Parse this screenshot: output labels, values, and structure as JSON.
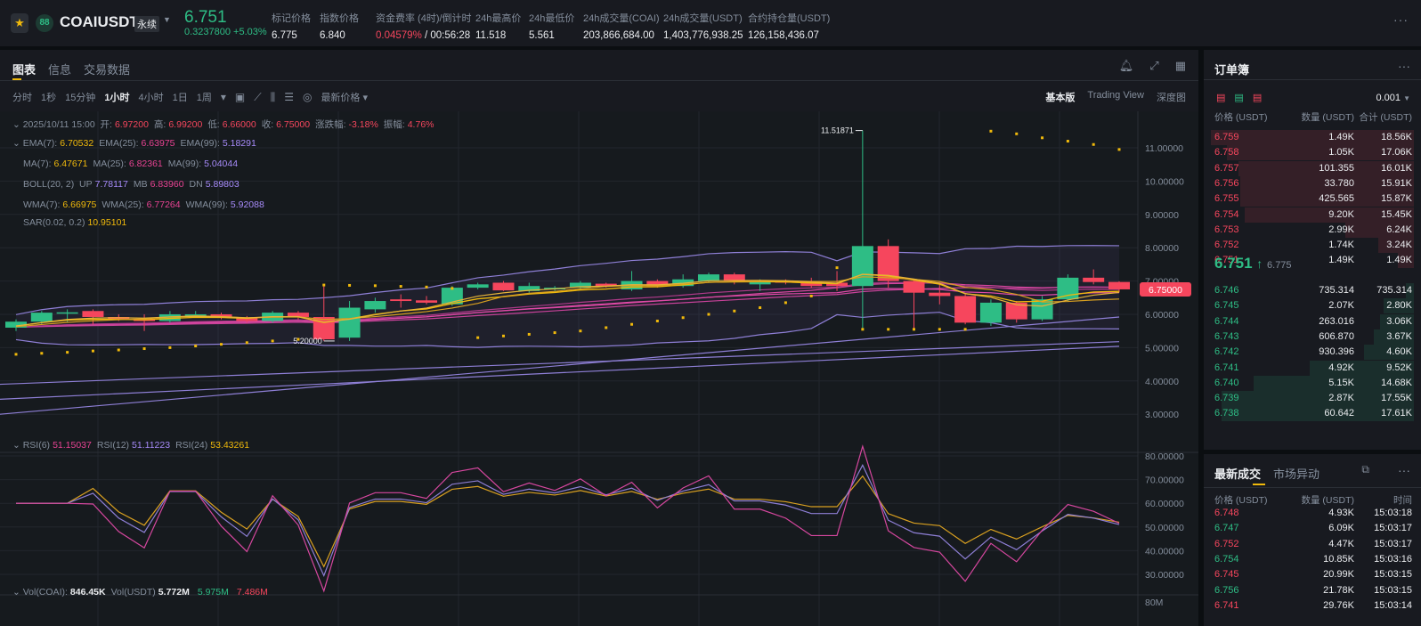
{
  "header": {
    "symbol": "COAIUSDT",
    "contract_type": "永续",
    "last_price": "6.751",
    "change": "0.3237800 +5.03%",
    "stats": [
      {
        "label": "标记价格",
        "value": "6.775"
      },
      {
        "label": "指数价格",
        "value": "6.840"
      },
      {
        "label": "资金费率 (4时)/倒计时",
        "value_rate": "0.04579%",
        "value": "/ 00:56:28"
      },
      {
        "label": "24h最高价",
        "value": "11.518"
      },
      {
        "label": "24h最低价",
        "value": "5.561"
      },
      {
        "label": "24h成交量(COAI)",
        "value": "203,866,684.00"
      },
      {
        "label": "24h成交量(USDT)",
        "value": "1,403,776,938.25"
      },
      {
        "label": "合约持仓量(USDT)",
        "value": "126,158,436.07"
      }
    ]
  },
  "tabs": [
    "图表",
    "信息",
    "交易数据"
  ],
  "toolbar": {
    "intervals": [
      "分时",
      "1秒",
      "15分钟",
      "1小时",
      "4小时",
      "1日",
      "1周"
    ],
    "active": "1小时",
    "price_type": "最新价格",
    "views": [
      "基本版",
      "Trading View",
      "深度图"
    ]
  },
  "indicators": {
    "ohlc": {
      "date": "2025/10/11 15:00",
      "open_l": "开:",
      "open": "6.97200",
      "high_l": "高:",
      "high": "6.99200",
      "low_l": "低:",
      "low": "6.66000",
      "close_l": "收:",
      "close": "6.75000",
      "chg_l": "涨跌幅:",
      "chg": "-3.18%",
      "amp_l": "振幅:",
      "amp": "4.76%"
    },
    "ema": {
      "l1": "EMA(7):",
      "v1": "6.70532",
      "l2": "EMA(25):",
      "v2": "6.63975",
      "l3": "EMA(99):",
      "v3": "5.18291"
    },
    "ma": {
      "l1": "MA(7):",
      "v1": "6.47671",
      "l2": "MA(25):",
      "v2": "6.82361",
      "l3": "MA(99):",
      "v3": "5.04044"
    },
    "boll": {
      "l": "BOLL(20, 2)",
      "l1": "UP",
      "v1": "7.78117",
      "l2": "MB",
      "v2": "6.83960",
      "l3": "DN",
      "v3": "5.89803"
    },
    "wma": {
      "l1": "WMA(7):",
      "v1": "6.66975",
      "l2": "WMA(25):",
      "v2": "6.77264",
      "l3": "WMA(99):",
      "v3": "5.92088"
    },
    "sar": {
      "l": "SAR(0.02, 0.2)",
      "v": "10.95101"
    },
    "rsi": {
      "l1": "RSI(6)",
      "v1": "51.15037",
      "l2": "RSI(12)",
      "v2": "51.11223",
      "l3": "RSI(24)",
      "v3": "53.43261"
    },
    "vol": {
      "l1": "Vol(COAI):",
      "v1": "846.45K",
      "l2": "Vol(USDT)",
      "v2": "5.772M",
      "v3": "5.975M",
      "v4": "7.486M"
    }
  },
  "chart_data": {
    "type": "candlestick",
    "interval": "1h",
    "ylim": [
      2.5,
      11.5
    ],
    "y_ticks": [
      "11.00000",
      "10.00000",
      "9.00000",
      "8.00000",
      "7.00000",
      "6.00000",
      "5.00000",
      "4.00000",
      "3.00000"
    ],
    "rsi_ticks": [
      "80.00000",
      "70.00000",
      "60.00000",
      "50.00000",
      "40.00000",
      "30.00000"
    ],
    "vol_tick": "80M",
    "last_label": "6.75000",
    "high_marker": "11.51871",
    "low_marker": "5.20000",
    "candles": [
      [
        5.6,
        5.85,
        5.5,
        5.78
      ],
      [
        5.78,
        6.1,
        5.7,
        6.05
      ],
      [
        6.05,
        6.15,
        5.75,
        6.06
      ],
      [
        6.1,
        6.15,
        5.7,
        5.92
      ],
      [
        5.92,
        6.0,
        5.8,
        5.85
      ],
      [
        5.85,
        6.0,
        5.5,
        5.8
      ],
      [
        5.8,
        6.1,
        5.75,
        6.0
      ],
      [
        5.95,
        6.1,
        5.9,
        6.0
      ],
      [
        6.0,
        6.05,
        5.85,
        5.9
      ],
      [
        5.9,
        5.95,
        5.75,
        5.8
      ],
      [
        5.8,
        6.1,
        5.75,
        6.05
      ],
      [
        6.05,
        6.1,
        5.85,
        5.92
      ],
      [
        5.92,
        6.88,
        5.2,
        5.25
      ],
      [
        5.3,
        6.4,
        5.2,
        6.2
      ],
      [
        6.15,
        6.5,
        6.05,
        6.4
      ],
      [
        6.45,
        6.6,
        6.2,
        6.4
      ],
      [
        6.42,
        6.55,
        6.3,
        6.35
      ],
      [
        6.3,
        6.85,
        6.25,
        6.8
      ],
      [
        6.8,
        6.95,
        6.75,
        6.9
      ],
      [
        6.95,
        7.0,
        6.7,
        6.72
      ],
      [
        6.7,
        6.95,
        6.65,
        6.85
      ],
      [
        6.75,
        6.85,
        6.7,
        6.8
      ],
      [
        6.8,
        7.0,
        6.75,
        6.95
      ],
      [
        6.92,
        6.95,
        6.8,
        6.85
      ],
      [
        6.75,
        7.3,
        6.7,
        7.0
      ],
      [
        7.0,
        7.05,
        6.8,
        6.85
      ],
      [
        6.85,
        7.2,
        6.8,
        7.05
      ],
      [
        7.0,
        7.25,
        6.95,
        7.2
      ],
      [
        7.2,
        7.25,
        6.9,
        7.0
      ],
      [
        6.9,
        7.05,
        6.7,
        7.0
      ],
      [
        7.0,
        7.05,
        6.9,
        6.95
      ],
      [
        7.0,
        7.1,
        6.8,
        6.85
      ],
      [
        6.95,
        7.3,
        6.7,
        6.85
      ],
      [
        6.85,
        11.51871,
        5.55,
        8.05
      ],
      [
        8.05,
        8.25,
        6.8,
        7.0
      ],
      [
        7.0,
        7.05,
        5.55,
        6.65
      ],
      [
        6.65,
        6.9,
        6.3,
        6.55
      ],
      [
        6.55,
        6.6,
        5.7,
        5.75
      ],
      [
        5.75,
        6.45,
        5.65,
        6.35
      ],
      [
        6.35,
        6.4,
        5.75,
        5.85
      ],
      [
        5.85,
        6.55,
        5.8,
        6.45
      ],
      [
        6.45,
        7.2,
        6.4,
        7.1
      ],
      [
        7.1,
        7.35,
        6.9,
        6.97
      ],
      [
        6.972,
        6.992,
        6.66,
        6.75
      ]
    ],
    "sar": [
      4.8,
      4.83,
      4.86,
      4.9,
      4.93,
      4.97,
      5.0,
      5.05,
      5.1,
      5.15,
      5.2,
      5.25,
      6.88,
      6.87,
      6.86,
      6.84,
      6.82,
      6.78,
      5.3,
      5.35,
      5.4,
      5.45,
      5.5,
      5.6,
      5.7,
      5.8,
      5.9,
      6.0,
      6.1,
      6.2,
      6.35,
      6.55,
      7.4,
      5.55,
      5.55,
      5.55,
      5.55,
      5.55,
      11.5,
      11.42,
      11.3,
      11.2,
      11.1,
      10.95
    ],
    "long_lines": [
      {
        "name": "EMA(99)",
        "start": 3.9,
        "end": 5.18
      },
      {
        "name": "MA(99)",
        "start": 3.45,
        "end": 5.04
      },
      {
        "name": "WMA(99)",
        "start": 3.0,
        "end": 5.92
      }
    ]
  },
  "orderbook": {
    "title": "订单簿",
    "tick": "0.001",
    "headers": [
      "价格 (USDT)",
      "数量 (USDT)",
      "合计 (USDT)"
    ],
    "asks": [
      [
        "6.759",
        "1.49K",
        "18.56K"
      ],
      [
        "6.758",
        "1.05K",
        "17.06K"
      ],
      [
        "6.757",
        "101.355",
        "16.01K"
      ],
      [
        "6.756",
        "33.780",
        "15.91K"
      ],
      [
        "6.755",
        "425.565",
        "15.87K"
      ],
      [
        "6.754",
        "9.20K",
        "15.45K"
      ],
      [
        "6.753",
        "2.99K",
        "6.24K"
      ],
      [
        "6.752",
        "1.74K",
        "3.24K"
      ],
      [
        "6.751",
        "1.49K",
        "1.49K"
      ]
    ],
    "mid_price": "6.751",
    "mark_price": "6.775",
    "bids": [
      [
        "6.746",
        "735.314",
        "735.314"
      ],
      [
        "6.745",
        "2.07K",
        "2.80K"
      ],
      [
        "6.744",
        "263.016",
        "3.06K"
      ],
      [
        "6.743",
        "606.870",
        "3.67K"
      ],
      [
        "6.742",
        "930.396",
        "4.60K"
      ],
      [
        "6.741",
        "4.92K",
        "9.52K"
      ],
      [
        "6.740",
        "5.15K",
        "14.68K"
      ],
      [
        "6.739",
        "2.87K",
        "17.55K"
      ],
      [
        "6.738",
        "60.642",
        "17.61K"
      ]
    ]
  },
  "trades": {
    "tabs": [
      "最新成交",
      "市场异动"
    ],
    "headers": [
      "价格 (USDT)",
      "数量 (USDT)",
      "时间"
    ],
    "rows": [
      [
        "6.748",
        "4.93K",
        "15:03:18",
        "sell"
      ],
      [
        "6.747",
        "6.09K",
        "15:03:17",
        "buy"
      ],
      [
        "6.752",
        "4.47K",
        "15:03:17",
        "sell"
      ],
      [
        "6.754",
        "10.85K",
        "15:03:16",
        "buy"
      ],
      [
        "6.745",
        "20.99K",
        "15:03:15",
        "sell"
      ],
      [
        "6.756",
        "21.78K",
        "15:03:15",
        "buy"
      ],
      [
        "6.741",
        "29.76K",
        "15:03:14",
        "sell"
      ]
    ]
  },
  "colors": {
    "up": "#2ebd85",
    "down": "#f6465d",
    "accent": "#f0b90b"
  }
}
